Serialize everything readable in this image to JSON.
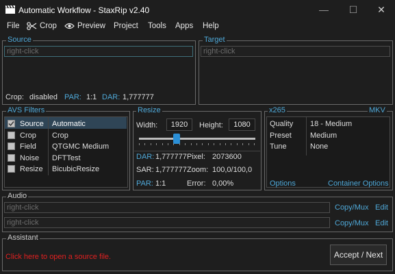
{
  "window": {
    "title": "Automatic Workflow - StaxRip v2.40",
    "minimize": "—",
    "maximize": "☐",
    "close": "✕"
  },
  "menu": {
    "file": "File",
    "crop": "Crop",
    "preview": "Preview",
    "project": "Project",
    "tools": "Tools",
    "apps": "Apps",
    "help": "Help"
  },
  "source": {
    "label": "Source",
    "placeholder": "right-click",
    "crop_label": "Crop:",
    "crop_value": "disabled",
    "par_label": "PAR:",
    "par_value": "1:1",
    "dar_label": "DAR:",
    "dar_value": "1,777777"
  },
  "target": {
    "label": "Target",
    "placeholder": "right-click"
  },
  "filters": {
    "label": "AVS Filters",
    "rows": [
      {
        "name": "Source",
        "value": "Automatic",
        "checked": true
      },
      {
        "name": "Crop",
        "value": "Crop",
        "checked": false
      },
      {
        "name": "Field",
        "value": "QTGMC Medium",
        "checked": false
      },
      {
        "name": "Noise",
        "value": "DFTTest",
        "checked": false
      },
      {
        "name": "Resize",
        "value": "BicubicResize",
        "checked": false
      }
    ]
  },
  "resize": {
    "label": "Resize",
    "width_label": "Width:",
    "width": "1920",
    "height_label": "Height:",
    "height": "1080",
    "slider_fraction": 0.31,
    "dar_label": "DAR:",
    "dar": "1,777777",
    "pixel_label": "Pixel:",
    "pixel": "2073600",
    "sar_label": "SAR:",
    "sar": "1,777777",
    "zoom_label": "Zoom:",
    "zoom": "100,0/100,0",
    "par_label": "PAR:",
    "par": "1:1",
    "error_label": "Error:",
    "error": "0,00%"
  },
  "encoder": {
    "label": "x265",
    "container": "MKV",
    "rows": [
      {
        "name": "Quality",
        "value": "18 - Medium"
      },
      {
        "name": "Preset",
        "value": "Medium"
      },
      {
        "name": "Tune",
        "value": "None"
      }
    ],
    "options": "Options",
    "container_options": "Container Options"
  },
  "audio": {
    "label": "Audio",
    "tracks": [
      {
        "placeholder": "right-click",
        "copy": "Copy/Mux",
        "edit": "Edit"
      },
      {
        "placeholder": "right-click",
        "copy": "Copy/Mux",
        "edit": "Edit"
      }
    ]
  },
  "assistant": {
    "label": "Assistant",
    "message": "Click here to open a source file.",
    "next": "Accept / Next"
  },
  "colors": {
    "accent": "#4fa9d9",
    "background": "#1e1e1e",
    "error": "#e02020",
    "slider_thumb": "#2b8fd6"
  }
}
